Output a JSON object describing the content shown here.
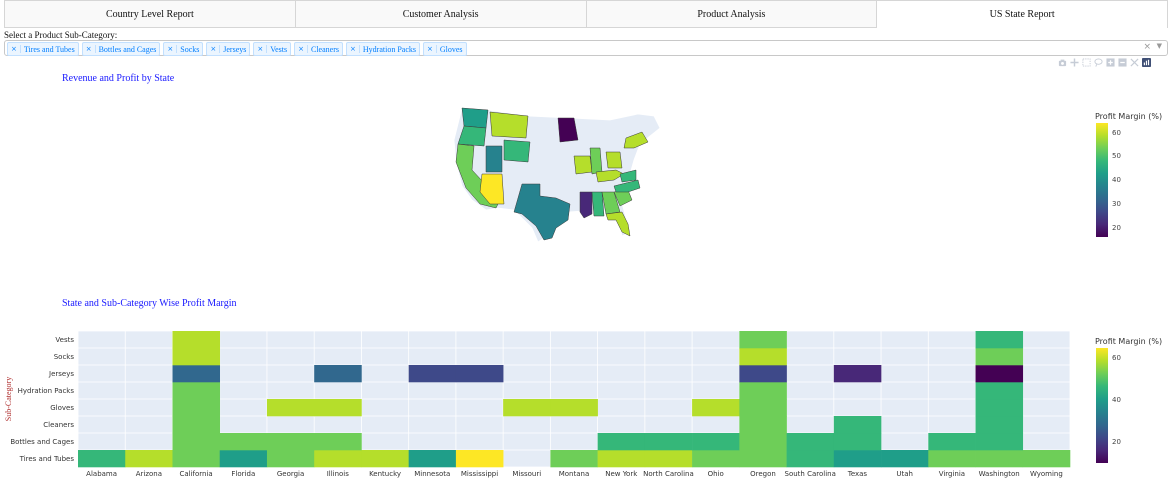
{
  "tabs": [
    {
      "label": "Country Level Report",
      "active": false
    },
    {
      "label": "Customer Analysis",
      "active": false
    },
    {
      "label": "Product Analysis",
      "active": false
    },
    {
      "label": "US State Report",
      "active": true
    }
  ],
  "filter": {
    "label": "Select a Product Sub-Category:",
    "chips": [
      "Tires and Tubes",
      "Bottles and Cages",
      "Socks",
      "Jerseys",
      "Vests",
      "Cleaners",
      "Hydration Packs",
      "Gloves"
    ],
    "clear_glyph": "×",
    "arrow_glyph": "▼",
    "remove_glyph": "×"
  },
  "modebar": [
    "camera-icon",
    "zoom-icon",
    "pan-icon",
    "lasso-icon",
    "zoom-in-icon",
    "zoom-out-icon",
    "autoscale-icon",
    "plotly-logo-icon"
  ],
  "colorscale": [
    "#440154",
    "#482878",
    "#3e4989",
    "#31688e",
    "#26828e",
    "#1f9e89",
    "#35b779",
    "#6ece58",
    "#b5de2b",
    "#fde725"
  ],
  "map_chart": {
    "title": "Revenue and Profit by State",
    "type": "choropleth",
    "no_data_color": "#e5ecf6",
    "colorbar": {
      "title": "Profit Margin (%)",
      "ticks": [
        20,
        30,
        40,
        50,
        60
      ],
      "range": [
        16,
        64
      ]
    },
    "states": [
      {
        "state": "Washington",
        "margin": 42
      },
      {
        "state": "Oregon",
        "margin": 46
      },
      {
        "state": "California",
        "margin": 52
      },
      {
        "state": "Montana",
        "margin": 56
      },
      {
        "state": "Wyoming",
        "margin": 50
      },
      {
        "state": "Utah",
        "margin": 38
      },
      {
        "state": "Arizona",
        "margin": 62
      },
      {
        "state": "Texas",
        "margin": 37
      },
      {
        "state": "Minnesota",
        "margin": 18
      },
      {
        "state": "Missouri",
        "margin": 57
      },
      {
        "state": "Illinois",
        "margin": 54
      },
      {
        "state": "Kentucky",
        "margin": 57
      },
      {
        "state": "Ohio",
        "margin": 59
      },
      {
        "state": "Mississippi",
        "margin": 23
      },
      {
        "state": "Alabama",
        "margin": 47
      },
      {
        "state": "Georgia",
        "margin": 55
      },
      {
        "state": "Florida",
        "margin": 56
      },
      {
        "state": "South Carolina",
        "margin": 52
      },
      {
        "state": "North Carolina",
        "margin": 49
      },
      {
        "state": "Virginia",
        "margin": 50
      },
      {
        "state": "New York",
        "margin": 57
      }
    ]
  },
  "chart_data": {
    "type": "heatmap",
    "title": "State and Sub-Category Wise Profit Margin",
    "xlabel": "",
    "ylabel": "Sub-Category",
    "x": [
      "Alabama",
      "Arizona",
      "California",
      "Florida",
      "Georgia",
      "Illinois",
      "Kentucky",
      "Minnesota",
      "Mississippi",
      "Missouri",
      "Montana",
      "New York",
      "North Carolina",
      "Ohio",
      "Oregon",
      "South Carolina",
      "Texas",
      "Utah",
      "Virginia",
      "Washington",
      "Wyoming"
    ],
    "y": [
      "Tires and Tubes",
      "Bottles and Cages",
      "Cleaners",
      "Gloves",
      "Hydration Packs",
      "Jerseys",
      "Socks",
      "Vests"
    ],
    "z": [
      [
        45,
        58,
        55,
        40,
        54,
        57,
        57,
        38,
        62,
        null,
        54,
        56,
        56,
        52,
        55,
        45,
        40,
        40,
        52,
        52,
        54
      ],
      [
        null,
        null,
        55,
        54,
        54,
        52,
        null,
        null,
        null,
        null,
        null,
        49,
        49,
        49,
        54,
        45,
        46,
        null,
        45,
        48,
        null
      ],
      [
        null,
        null,
        55,
        null,
        null,
        null,
        null,
        null,
        null,
        null,
        null,
        null,
        null,
        null,
        54,
        null,
        49,
        null,
        null,
        48,
        null
      ],
      [
        null,
        null,
        55,
        null,
        58,
        58,
        null,
        null,
        null,
        57,
        57,
        null,
        null,
        57,
        54,
        null,
        null,
        null,
        null,
        48,
        null
      ],
      [
        null,
        null,
        55,
        null,
        null,
        null,
        null,
        null,
        null,
        null,
        null,
        null,
        null,
        null,
        54,
        null,
        null,
        null,
        null,
        48,
        null
      ],
      [
        null,
        null,
        31,
        null,
        null,
        26,
        null,
        23,
        23,
        null,
        null,
        null,
        null,
        null,
        22,
        null,
        18,
        null,
        null,
        12,
        null
      ],
      [
        null,
        null,
        61,
        null,
        null,
        null,
        null,
        null,
        null,
        null,
        null,
        null,
        null,
        null,
        58,
        null,
        null,
        null,
        null,
        54,
        null
      ],
      [
        null,
        null,
        57,
        null,
        null,
        null,
        null,
        null,
        null,
        null,
        null,
        null,
        null,
        null,
        54,
        null,
        null,
        null,
        null,
        48,
        null
      ]
    ],
    "zrange": [
      10,
      65
    ],
    "colorbar": {
      "title": "Profit Margin (%)",
      "ticks": [
        20,
        40,
        60
      ]
    },
    "grid": true
  }
}
